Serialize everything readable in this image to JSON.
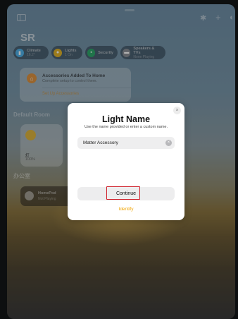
{
  "home": {
    "title": "SR",
    "toolbar_icons": [
      "sidebar-icon",
      "gear-icon",
      "plus-icon",
      "audio-icon"
    ]
  },
  "chips": [
    {
      "label": "Climate",
      "sub": "16.2°",
      "color": "#4fb0e8",
      "icon": "thermometer-icon"
    },
    {
      "label": "Lights",
      "sub": "1 On",
      "color": "#e0b22a",
      "icon": "bulb-icon"
    },
    {
      "label": "Security",
      "sub": "",
      "color": "#2fa66b",
      "icon": "lock-icon"
    },
    {
      "label": "Speakers & TVs",
      "sub": "None Playing",
      "color": "#8a8f95",
      "icon": "speaker-icon"
    }
  ],
  "accessories_banner": {
    "title": "Accessories Added To Home",
    "subtitle": "Complete setup to control them.",
    "link": "Set Up Accessories"
  },
  "sections": {
    "default_room": "Default Room",
    "second_room": "办公室"
  },
  "light_tile": {
    "name": "灯",
    "value": "100%"
  },
  "homepod_tile": {
    "name": "HomePod",
    "status": "Not Playing"
  },
  "modal": {
    "title": "Light Name",
    "subtitle": "Use the name provided or enter a custom name.",
    "name_value": "Matter Accessory",
    "continue_label": "Continue",
    "identify_label": "Identify",
    "close_glyph": "×",
    "clear_glyph": "×"
  },
  "colors": {
    "accent": "#f0a400",
    "highlight_border": "#d0212b"
  }
}
